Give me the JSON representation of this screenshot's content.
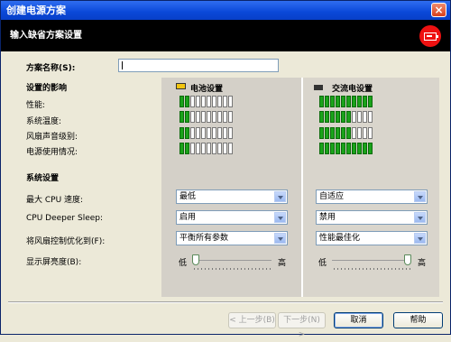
{
  "window": {
    "title": "创建电源方案",
    "close_glyph": "×"
  },
  "header": {
    "title": "输入缺省方案设置",
    "icon": "battery-icon",
    "accent": "#e11"
  },
  "scheme_name": {
    "label": "方案名称(S):",
    "value": ""
  },
  "impact": {
    "title": "设置的影响",
    "rows": [
      "性能:",
      "系统温度:",
      "风扇声音级别:",
      "电源使用情况:"
    ],
    "battery": {
      "title": "电池设置",
      "levels": [
        2,
        2,
        2,
        2
      ],
      "max": 10
    },
    "ac": {
      "title": "交流电设置",
      "levels": [
        10,
        6,
        6,
        10
      ],
      "max": 10
    }
  },
  "system": {
    "title": "系统设置",
    "rows": [
      {
        "label": "最大 CPU 速度:",
        "battery": "最低",
        "ac": "自适应"
      },
      {
        "label": "CPU Deeper Sleep:",
        "battery": "启用",
        "ac": "禁用"
      },
      {
        "label": "将风扇控制优化到(F):",
        "battery": "平衡所有参数",
        "ac": "性能最佳化"
      }
    ],
    "brightness": {
      "label": "显示屏亮度(B):",
      "low": "低",
      "high": "高",
      "battery_value": 0.0,
      "ac_value": 1.0
    }
  },
  "buttons": {
    "back": "< 上一步(B)",
    "next": "下一步(N) >",
    "cancel": "取消",
    "help": "帮助"
  },
  "colors": {
    "meter_on": "#1aa31a",
    "titlebar": "#0a48d8"
  }
}
